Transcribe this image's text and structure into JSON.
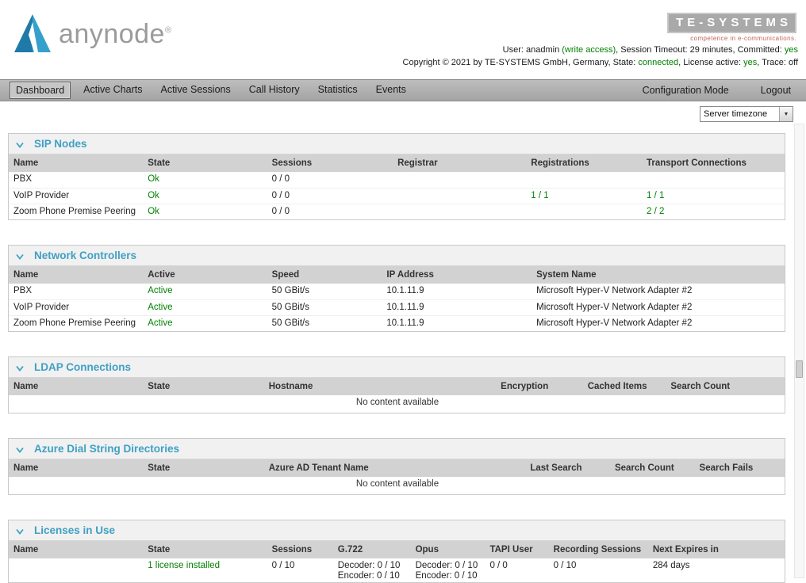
{
  "colors": {
    "accent_teal": "#3FA0C4",
    "status_green": "#008000",
    "brand_red": "#C4645C"
  },
  "header": {
    "logo_text": "anynode",
    "logo_reg": "®",
    "brand": {
      "name": "TE-SYSTEMS",
      "tagline": "competence in e-communications."
    },
    "user_line": {
      "prefix": "User: anadmin ",
      "write_access": "(write access)",
      "middle": ", Session Timeout: 29 minutes, Committed: ",
      "committed": "yes"
    },
    "copyright_line": {
      "prefix": "Copyright © 2021 by TE-SYSTEMS GmbH, Germany, State: ",
      "state": "connected",
      "mid1": ", License active: ",
      "license": "yes",
      "mid2": ", Trace: ",
      "trace": "off"
    }
  },
  "nav": {
    "items": [
      {
        "label": "Dashboard",
        "active": true
      },
      {
        "label": "Active Charts"
      },
      {
        "label": "Active Sessions"
      },
      {
        "label": "Call History"
      },
      {
        "label": "Statistics"
      },
      {
        "label": "Events"
      }
    ],
    "right_items": [
      {
        "label": "Configuration Mode"
      },
      {
        "label": "Logout"
      }
    ]
  },
  "toolbar": {
    "timezone_select": "Server timezone",
    "select_arrow_icon": "▼"
  },
  "sections": [
    {
      "id": "sip-nodes",
      "title": "SIP Nodes",
      "columns": [
        "Name",
        "State",
        "Sessions",
        "Registrar",
        "Registrations",
        "Transport Connections"
      ],
      "col_widths": [
        "17.3%",
        "16%",
        "16.2%",
        "17.2%",
        "14.9%",
        "18.4%"
      ],
      "rows": [
        [
          {
            "t": "PBX"
          },
          {
            "t": "Ok",
            "c": "green"
          },
          {
            "t": "0 / 0"
          },
          {
            "t": ""
          },
          {
            "t": ""
          },
          {
            "t": ""
          }
        ],
        [
          {
            "t": "VoIP Provider"
          },
          {
            "t": "Ok",
            "c": "green"
          },
          {
            "t": "0 / 0"
          },
          {
            "t": ""
          },
          {
            "t": "1 / 1",
            "c": "green"
          },
          {
            "t": "1 / 1",
            "c": "green"
          }
        ],
        [
          {
            "t": "Zoom Phone Premise Peering"
          },
          {
            "t": "Ok",
            "c": "green"
          },
          {
            "t": "0 / 0"
          },
          {
            "t": ""
          },
          {
            "t": ""
          },
          {
            "t": "2 / 2",
            "c": "green"
          }
        ]
      ],
      "empty_text": null
    },
    {
      "id": "network-controllers",
      "title": "Network Controllers",
      "columns": [
        "Name",
        "Active",
        "Speed",
        "IP Address",
        "System Name"
      ],
      "col_widths": [
        "17.3%",
        "16%",
        "14.8%",
        "19.3%",
        "32.6%"
      ],
      "rows": [
        [
          {
            "t": "PBX"
          },
          {
            "t": "Active",
            "c": "green"
          },
          {
            "t": "50 GBit/s"
          },
          {
            "t": "10.1.11.9"
          },
          {
            "t": "Microsoft Hyper-V Network Adapter #2"
          }
        ],
        [
          {
            "t": "VoIP Provider"
          },
          {
            "t": "Active",
            "c": "green"
          },
          {
            "t": "50 GBit/s"
          },
          {
            "t": "10.1.11.9"
          },
          {
            "t": "Microsoft Hyper-V Network Adapter #2"
          }
        ],
        [
          {
            "t": "Zoom Phone Premise Peering"
          },
          {
            "t": "Active",
            "c": "green"
          },
          {
            "t": "50 GBit/s"
          },
          {
            "t": "10.1.11.9"
          },
          {
            "t": "Microsoft Hyper-V Network Adapter #2"
          }
        ]
      ],
      "empty_text": null
    },
    {
      "id": "ldap-connections",
      "title": "LDAP Connections",
      "columns": [
        "Name",
        "State",
        "Hostname",
        "Encryption",
        "Cached Items",
        "Search Count"
      ],
      "col_widths": [
        "17.3%",
        "15.6%",
        "29.9%",
        "11.2%",
        "10.7%",
        "15.3%"
      ],
      "rows": [],
      "empty_text": "No content available"
    },
    {
      "id": "azure-dial-string-directories",
      "title": "Azure Dial String Directories",
      "columns": [
        "Name",
        "State",
        "Azure AD Tenant Name",
        "Last Search",
        "Search Count",
        "Search Fails"
      ],
      "col_widths": [
        "17.3%",
        "15.6%",
        "33.7%",
        "10.9%",
        "10.9%",
        "11.6%"
      ],
      "rows": [],
      "empty_text": "No content available"
    },
    {
      "id": "licenses-in-use",
      "title": "Licenses in Use",
      "columns": [
        "Name",
        "State",
        "Sessions",
        "G.722",
        "Opus",
        "TAPI User",
        "Recording Sessions",
        "Next Expires in"
      ],
      "col_widths": [
        "17.3%",
        "16%",
        "8.5%",
        "10%",
        "9.6%",
        "8.2%",
        "12.8%",
        "17.6%"
      ],
      "rows": [
        [
          {
            "t": ""
          },
          {
            "t": "1 license installed",
            "c": "green"
          },
          {
            "t": "0 / 10"
          },
          {
            "t": "Decoder: 0 / 10\nEncoder: 0 / 10"
          },
          {
            "t": "Decoder: 0 / 10\nEncoder: 0 / 10"
          },
          {
            "t": "0 / 0"
          },
          {
            "t": "0 / 10"
          },
          {
            "t": "284 days"
          }
        ]
      ],
      "empty_text": null
    }
  ]
}
